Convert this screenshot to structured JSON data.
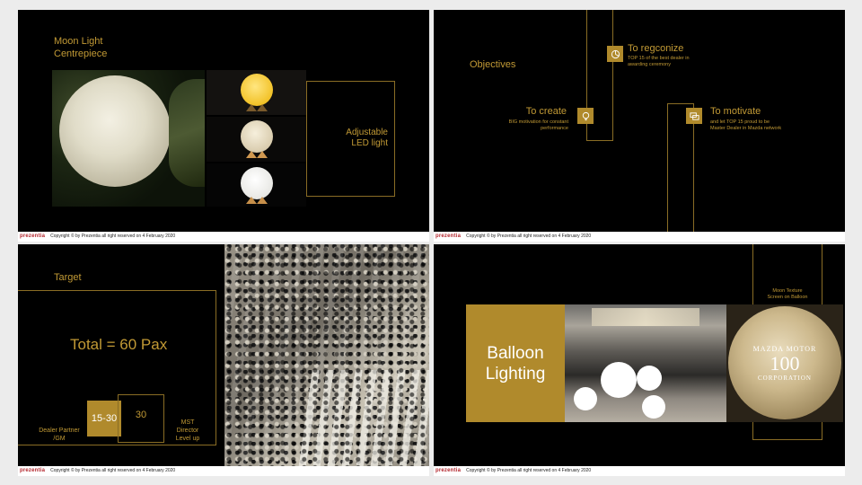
{
  "footer": {
    "brand": "prezentia",
    "copyright": "Copyright © by Prezentia all right reserved on 4 February 2020"
  },
  "slide1": {
    "title_line1": "Moon Light",
    "title_line2": "Centrepiece",
    "side_line1": "Adjustable",
    "side_line2": "LED light"
  },
  "slide2": {
    "objectives": "Objectives",
    "recognize_title": "To regconize",
    "recognize_text": "TOP 15 of the best dealer in awarding ceremony",
    "create_title": "To create",
    "create_text": "BIG motivation for constant performance",
    "motivate_title": "To motivate",
    "motivate_text": "and let TOP 15 proud to be Master Dealer in Mazda network",
    "icons": [
      "chart-icon",
      "lightbulb-icon",
      "chat-icon"
    ]
  },
  "slide3": {
    "target": "Target",
    "total": "Total = 60 Pax",
    "box1": "15-30",
    "box2": "30",
    "label_left_line1": "Dealer Partner",
    "label_left_line2": "/GM",
    "label_right_line1": "MST",
    "label_right_line2": "Director",
    "label_right_line3": "Level up"
  },
  "slide4": {
    "heading_line1": "Balloon",
    "heading_line2": "Lighting",
    "caption_line1": "Moon Texture",
    "caption_line2": "Screen on Balloon",
    "balloon_top": "MAZDA MOTOR",
    "balloon_number": "100",
    "balloon_bottom": "CORPORATION"
  },
  "colors": {
    "gold": "#c29a35",
    "gold_block": "#b08a2c",
    "background": "#000000"
  }
}
